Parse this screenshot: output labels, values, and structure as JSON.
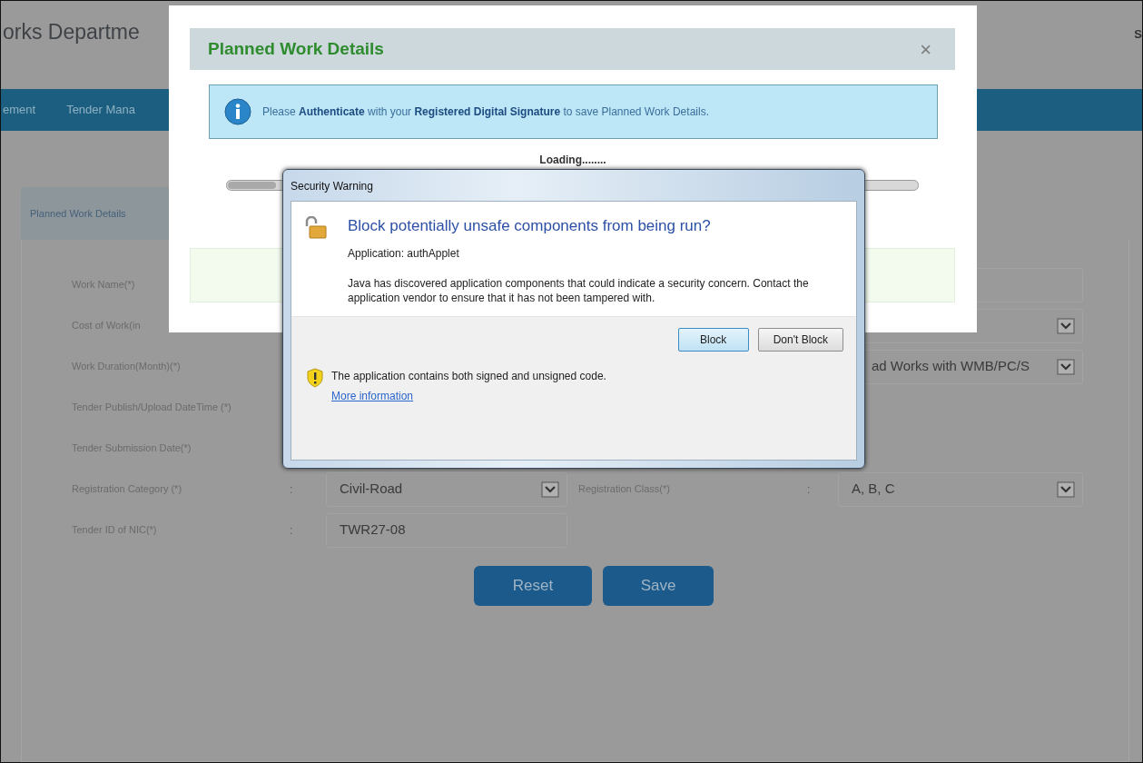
{
  "page": {
    "header_title": "orks Departme",
    "header_right": "S",
    "nav": [
      "ement",
      "Tender Mana"
    ],
    "tabs": [
      {
        "label": "Planned Work Details",
        "selected": true
      }
    ],
    "form": [
      {
        "label": "Work Name(*)",
        "right_field": {
          "kind": "text"
        }
      },
      {
        "label": "Cost of Work(in",
        "right_field": {
          "kind": "select"
        }
      },
      {
        "label": "Work Duration(Month)(*)",
        "right_field": {
          "kind": "select",
          "value": "ad Works with WMB/PC/S"
        }
      },
      {
        "label": "Tender Publish/Upload DateTime (*)"
      },
      {
        "label": "Tender Submission Date(*)"
      },
      {
        "label": "Registration Category (*)",
        "colon": ":",
        "right_colon": ":",
        "field": {
          "kind": "select",
          "value": "Civil-Road"
        },
        "right_label": "Registration Class(*)",
        "right_field": {
          "kind": "select",
          "value": "A, B, C"
        }
      },
      {
        "label": "Tender ID of NIC(*)",
        "colon": ":",
        "field": {
          "kind": "text",
          "value": "TWR27-08"
        }
      }
    ],
    "buttons": [
      "Reset",
      "Save"
    ]
  },
  "modal": {
    "title": "Planned Work Details",
    "close": "×",
    "alert": "Please **Authenticate** with your **Registered Digital Signature** to save Planned Work Details.",
    "loading": "Loading........",
    "progress": {
      "level": 0.07
    }
  },
  "dialog": {
    "title": "Security Warning",
    "heading": "Block potentially unsafe components from being run?",
    "application": "Application: authApplet",
    "body": "Java has discovered application components that could indicate a security concern. Contact the application vendor to ensure that it has not been tampered with.",
    "buttons": [
      {
        "label": "Block",
        "default": true
      },
      {
        "label": "Don't Block",
        "default": false
      }
    ],
    "footer": "The application contains both signed and unsigned code.",
    "link": "More information"
  }
}
